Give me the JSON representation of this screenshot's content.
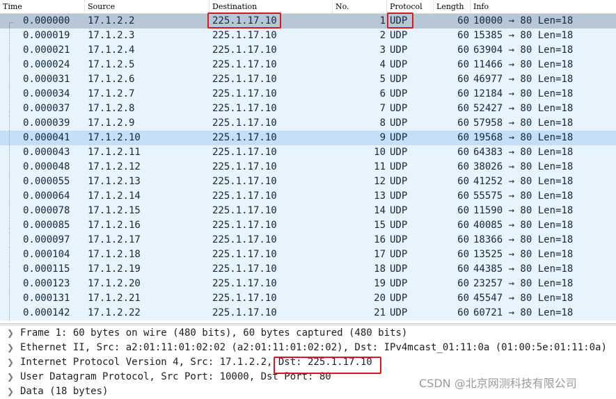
{
  "columns": {
    "time": "Time",
    "source": "Source",
    "destination": "Destination",
    "no": "No.",
    "protocol": "Protocol",
    "length": "Length",
    "info": "Info"
  },
  "packets": [
    {
      "time": "0.000000",
      "source": "17.1.2.2",
      "destination": "225.1.17.10",
      "no": "1",
      "protocol": "UDP",
      "length": "60",
      "info": "10000 → 80 Len=18"
    },
    {
      "time": "0.000019",
      "source": "17.1.2.3",
      "destination": "225.1.17.10",
      "no": "2",
      "protocol": "UDP",
      "length": "60",
      "info": "15385 → 80 Len=18"
    },
    {
      "time": "0.000021",
      "source": "17.1.2.4",
      "destination": "225.1.17.10",
      "no": "3",
      "protocol": "UDP",
      "length": "60",
      "info": "63904 → 80 Len=18"
    },
    {
      "time": "0.000024",
      "source": "17.1.2.5",
      "destination": "225.1.17.10",
      "no": "4",
      "protocol": "UDP",
      "length": "60",
      "info": "11466 → 80 Len=18"
    },
    {
      "time": "0.000031",
      "source": "17.1.2.6",
      "destination": "225.1.17.10",
      "no": "5",
      "protocol": "UDP",
      "length": "60",
      "info": "46977 → 80 Len=18"
    },
    {
      "time": "0.000034",
      "source": "17.1.2.7",
      "destination": "225.1.17.10",
      "no": "6",
      "protocol": "UDP",
      "length": "60",
      "info": "12184 → 80 Len=18"
    },
    {
      "time": "0.000037",
      "source": "17.1.2.8",
      "destination": "225.1.17.10",
      "no": "7",
      "protocol": "UDP",
      "length": "60",
      "info": "52427 → 80 Len=18"
    },
    {
      "time": "0.000039",
      "source": "17.1.2.9",
      "destination": "225.1.17.10",
      "no": "8",
      "protocol": "UDP",
      "length": "60",
      "info": "57958 → 80 Len=18"
    },
    {
      "time": "0.000041",
      "source": "17.1.2.10",
      "destination": "225.1.17.10",
      "no": "9",
      "protocol": "UDP",
      "length": "60",
      "info": "19568 → 80 Len=18"
    },
    {
      "time": "0.000043",
      "source": "17.1.2.11",
      "destination": "225.1.17.10",
      "no": "10",
      "protocol": "UDP",
      "length": "60",
      "info": "64383 → 80 Len=18"
    },
    {
      "time": "0.000048",
      "source": "17.1.2.12",
      "destination": "225.1.17.10",
      "no": "11",
      "protocol": "UDP",
      "length": "60",
      "info": "38026 → 80 Len=18"
    },
    {
      "time": "0.000055",
      "source": "17.1.2.13",
      "destination": "225.1.17.10",
      "no": "12",
      "protocol": "UDP",
      "length": "60",
      "info": "41252 → 80 Len=18"
    },
    {
      "time": "0.000064",
      "source": "17.1.2.14",
      "destination": "225.1.17.10",
      "no": "13",
      "protocol": "UDP",
      "length": "60",
      "info": "55575 → 80 Len=18"
    },
    {
      "time": "0.000078",
      "source": "17.1.2.15",
      "destination": "225.1.17.10",
      "no": "14",
      "protocol": "UDP",
      "length": "60",
      "info": "11590 → 80 Len=18"
    },
    {
      "time": "0.000085",
      "source": "17.1.2.16",
      "destination": "225.1.17.10",
      "no": "15",
      "protocol": "UDP",
      "length": "60",
      "info": "40085 → 80 Len=18"
    },
    {
      "time": "0.000097",
      "source": "17.1.2.17",
      "destination": "225.1.17.10",
      "no": "16",
      "protocol": "UDP",
      "length": "60",
      "info": "18366 → 80 Len=18"
    },
    {
      "time": "0.000104",
      "source": "17.1.2.18",
      "destination": "225.1.17.10",
      "no": "17",
      "protocol": "UDP",
      "length": "60",
      "info": "13525 → 80 Len=18"
    },
    {
      "time": "0.000115",
      "source": "17.1.2.19",
      "destination": "225.1.17.10",
      "no": "18",
      "protocol": "UDP",
      "length": "60",
      "info": "44385 → 80 Len=18"
    },
    {
      "time": "0.000123",
      "source": "17.1.2.20",
      "destination": "225.1.17.10",
      "no": "19",
      "protocol": "UDP",
      "length": "60",
      "info": "23257 → 80 Len=18"
    },
    {
      "time": "0.000131",
      "source": "17.1.2.21",
      "destination": "225.1.17.10",
      "no": "20",
      "protocol": "UDP",
      "length": "60",
      "info": "45547 → 80 Len=18"
    },
    {
      "time": "0.000142",
      "source": "17.1.2.22",
      "destination": "225.1.17.10",
      "no": "21",
      "protocol": "UDP",
      "length": "60",
      "info": "60721 → 80 Len=18"
    }
  ],
  "details": [
    "Frame 1: 60 bytes on wire (480 bits), 60 bytes captured (480 bits)",
    "Ethernet II, Src: a2:01:11:01:02:02 (a2:01:11:01:02:02), Dst: IPv4mcast_01:11:0a (01:00:5e:01:11:0a)",
    "Internet Protocol Version 4, Src: 17.1.2.2, Dst: 225.1.17.10",
    "User Datagram Protocol, Src Port: 10000, Dst Port: 80",
    "Data (18 bytes)"
  ],
  "expand_icon": "chevron-right-icon",
  "watermark": "CSDN @北京网测科技有限公司",
  "colors": {
    "row_bg": "#e7f3fd",
    "selected_bg": "#b7c7d6",
    "hover_bg": "#c4dff7",
    "annotation": "#e0141e"
  }
}
